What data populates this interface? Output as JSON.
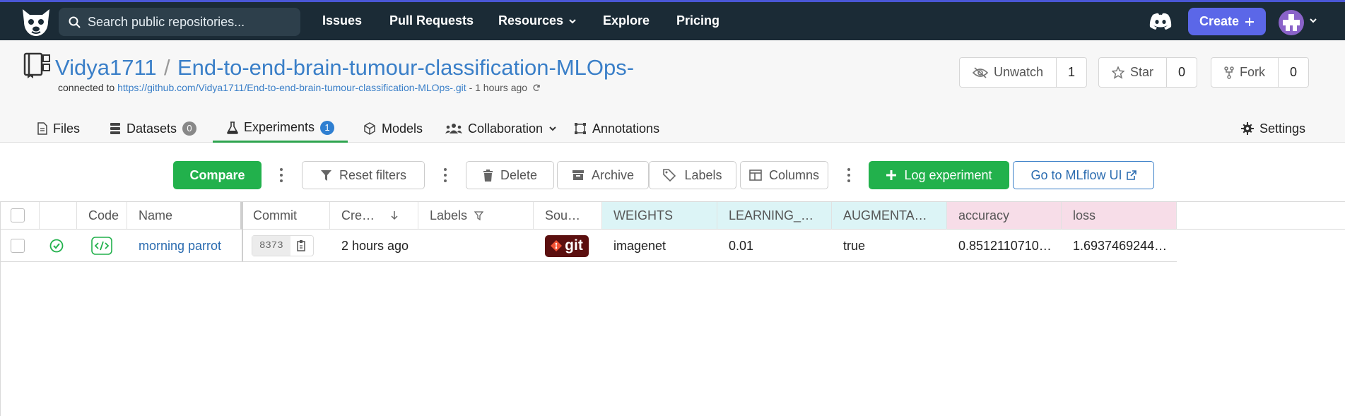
{
  "topbar": {
    "search_placeholder": "Search public repositories...",
    "nav": [
      "Issues",
      "Pull Requests",
      "Resources",
      "Explore",
      "Pricing"
    ],
    "create_label": "Create"
  },
  "repo": {
    "owner": "Vidya1711",
    "separator": "/",
    "name": "End-to-end-brain-tumour-classification-MLOps-",
    "connected_prefix": "connected to",
    "connected_url": "https://github.com/Vidya1711/End-to-end-brain-tumour-classification-MLOps-.git",
    "connected_ago": "- 1 hours ago",
    "unwatch_label": "Unwatch",
    "watch_count": "1",
    "star_label": "Star",
    "star_count": "0",
    "fork_label": "Fork",
    "fork_count": "0"
  },
  "tabs": {
    "files": "Files",
    "datasets": "Datasets",
    "datasets_count": "0",
    "experiments": "Experiments",
    "experiments_count": "1",
    "models": "Models",
    "collaboration": "Collaboration",
    "annotations": "Annotations",
    "settings": "Settings"
  },
  "toolbar": {
    "compare": "Compare",
    "reset_filters": "Reset filters",
    "delete": "Delete",
    "archive": "Archive",
    "labels": "Labels",
    "columns": "Columns",
    "log_experiment": "Log experiment",
    "mlflow": "Go to MLflow UI"
  },
  "table": {
    "headers": {
      "code": "Code",
      "name": "Name",
      "commit": "Commit",
      "created": "Cre…",
      "labels": "Labels",
      "source": "Sou…",
      "weights": "WEIGHTS",
      "learning": "LEARNING_…",
      "augmentation": "AUGMENTA…",
      "accuracy": "accuracy",
      "loss": "loss"
    },
    "row": {
      "name": "morning parrot",
      "commit": "8373",
      "created": "2 hours ago",
      "source": "git",
      "weights": "imagenet",
      "learning": "0.01",
      "augmentation": "true",
      "accuracy": "0.8512110710…",
      "loss": "1.6937469244…"
    }
  },
  "colors": {
    "topbar": "#1b2b36",
    "create": "#5b67e8",
    "green": "#22b14c",
    "link": "#3a7fc8",
    "param_header": "#dcf4f6",
    "metric_header": "#f7dde8"
  }
}
